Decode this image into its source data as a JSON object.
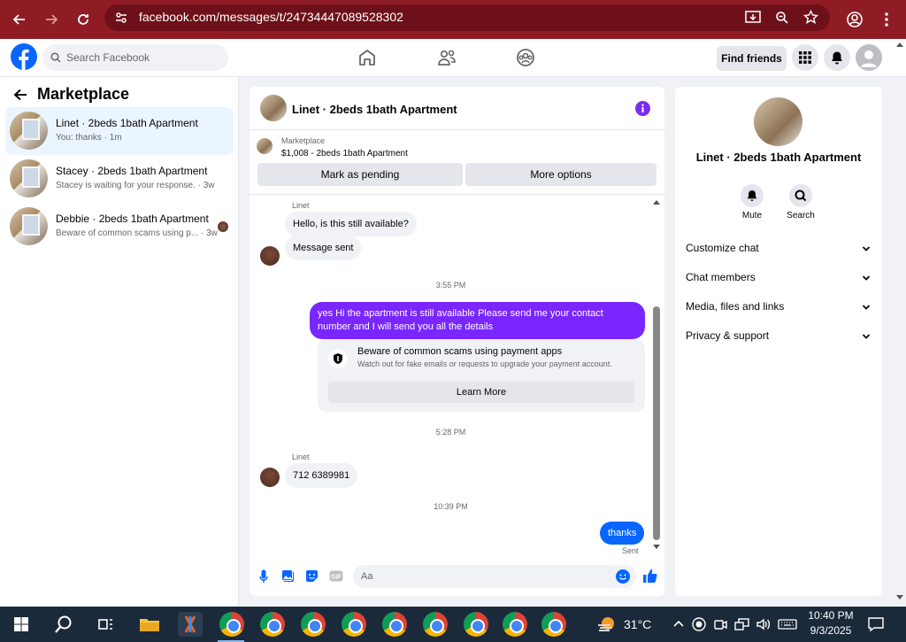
{
  "browser": {
    "url": "facebook.com/messages/t/24734447089528302"
  },
  "fb": {
    "search_placeholder": "Search Facebook",
    "find_friends": "Find friends"
  },
  "left_panel": {
    "title": "Marketplace",
    "conversations": [
      {
        "name": "Linet · 2beds 1bath Apartment",
        "preview": "You: thanks · 1m"
      },
      {
        "name": "Stacey · 2beds 1bath Apartment",
        "preview": "Stacey is waiting for your response. · 3w"
      },
      {
        "name": "Debbie · 2beds 1bath Apartment",
        "preview": "Beware of common scams using p... · 3w"
      }
    ]
  },
  "chat": {
    "title": "Linet · 2beds 1bath Apartment",
    "listing_source": "Marketplace",
    "listing_price_title": "$1,008 - 2beds 1bath Apartment",
    "mark_pending": "Mark as pending",
    "more_options": "More options",
    "messages": {
      "sender1": "Linet",
      "msg1": "Hello, is this still available?",
      "msg2": "Message sent",
      "time1": "3:55 PM",
      "msg3": "yes Hi the apartment is still available Please send me your contact number and I will send you all the details",
      "notice_title": "Beware of common scams using payment apps",
      "notice_body": "Watch out for fake emails or requests to upgrade your payment account.",
      "learn_more": "Learn More",
      "time2": "5:28 PM",
      "sender2": "Linet",
      "msg4": "712 6389981",
      "time3": "10:39 PM",
      "msg5": "thanks",
      "status": "Sent"
    },
    "composer_placeholder": "Aa"
  },
  "right_panel": {
    "name": "Linet · 2beds 1bath Apartment",
    "mute": "Mute",
    "search": "Search",
    "sections": [
      "Customize chat",
      "Chat members",
      "Media, files and links",
      "Privacy & support"
    ]
  },
  "taskbar": {
    "temperature": "31°C",
    "time": "10:40 PM",
    "date": "9/3/2025"
  },
  "colors": {
    "browser_bar": "#8f1c24",
    "accent": "#0866ff",
    "outgoing_bubble": "#7a26ff",
    "info": "#7b2cf0"
  }
}
